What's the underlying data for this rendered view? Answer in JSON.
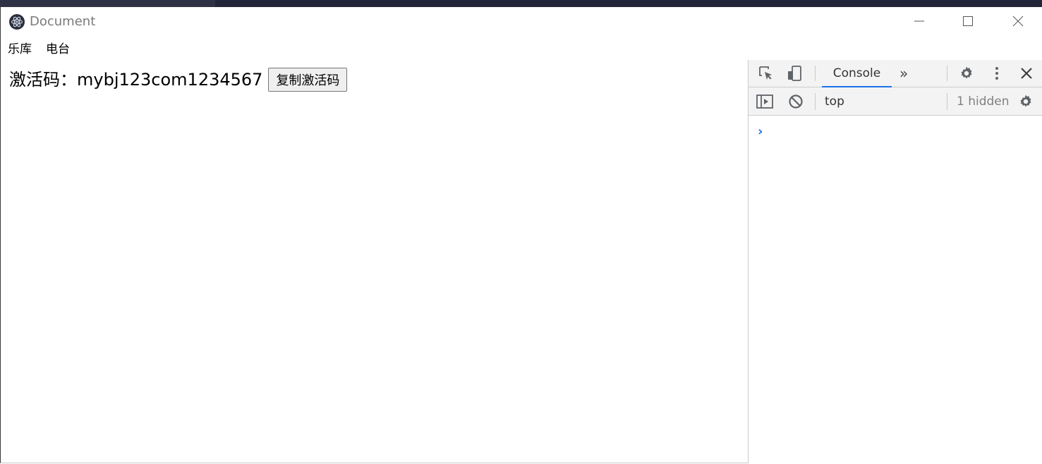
{
  "window": {
    "title": "Document"
  },
  "menu": {
    "items": [
      {
        "label": "乐库"
      },
      {
        "label": "电台"
      }
    ]
  },
  "content": {
    "activation_code_text": "激活码：mybj123com1234567",
    "copy_button_label": "复制激活码"
  },
  "devtools": {
    "tabs": {
      "active_tab": "Console",
      "more_tabs_glyph": "»"
    },
    "console_toolbar": {
      "context": "top",
      "hidden_count": "1 hidden"
    },
    "prompt_glyph": "›",
    "colors": {
      "accent": "#1a73e8",
      "toolbar_bg": "#f3f3f3",
      "divider": "#cbcbcb"
    }
  }
}
